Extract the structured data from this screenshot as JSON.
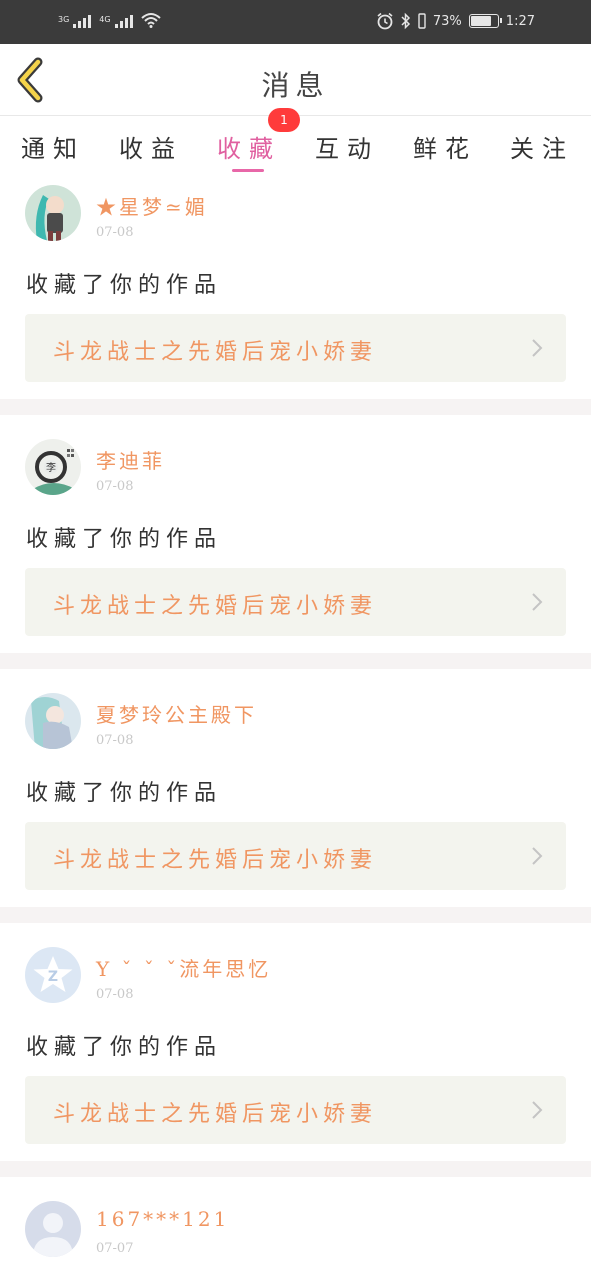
{
  "status_bar": {
    "sim1": "3G",
    "sim2": "4G",
    "battery_percent": "73%",
    "battery_level": 0.73,
    "time": "1:27",
    "icons": [
      "signal-icon",
      "signal-icon",
      "wifi-icon",
      "alarm-icon",
      "bluetooth-icon",
      "vibrate-icon",
      "battery-icon"
    ]
  },
  "header": {
    "title": "消息",
    "back_icon": "chevron-left-icon"
  },
  "tabs": [
    {
      "label": "通知",
      "active": false
    },
    {
      "label": "收益",
      "active": false
    },
    {
      "label": "收藏",
      "active": true,
      "badge": "1"
    },
    {
      "label": "互动",
      "active": false
    },
    {
      "label": "鲜花",
      "active": false
    },
    {
      "label": "关注",
      "active": false
    }
  ],
  "colors": {
    "accent": "#e867a8",
    "username": "#f09662",
    "badge": "#ff3b3b",
    "card_bg": "#f3f4ee"
  },
  "messages": [
    {
      "user": "★星梦≃媚",
      "date": "07-08",
      "action": "收藏了你的作品",
      "work": "斗龙战士之先婚后宠小娇妻"
    },
    {
      "user": "李迪菲",
      "date": "07-08",
      "action": "收藏了你的作品",
      "work": "斗龙战士之先婚后宠小娇妻"
    },
    {
      "user": "夏梦玲公主殿下",
      "date": "07-08",
      "action": "收藏了你的作品",
      "work": "斗龙战士之先婚后宠小娇妻"
    },
    {
      "user": "Y ˇ ˇ ˇ流年思忆",
      "date": "07-08",
      "action": "收藏了你的作品",
      "work": "斗龙战士之先婚后宠小娇妻"
    },
    {
      "user": "167***121",
      "date": "07-07"
    }
  ]
}
